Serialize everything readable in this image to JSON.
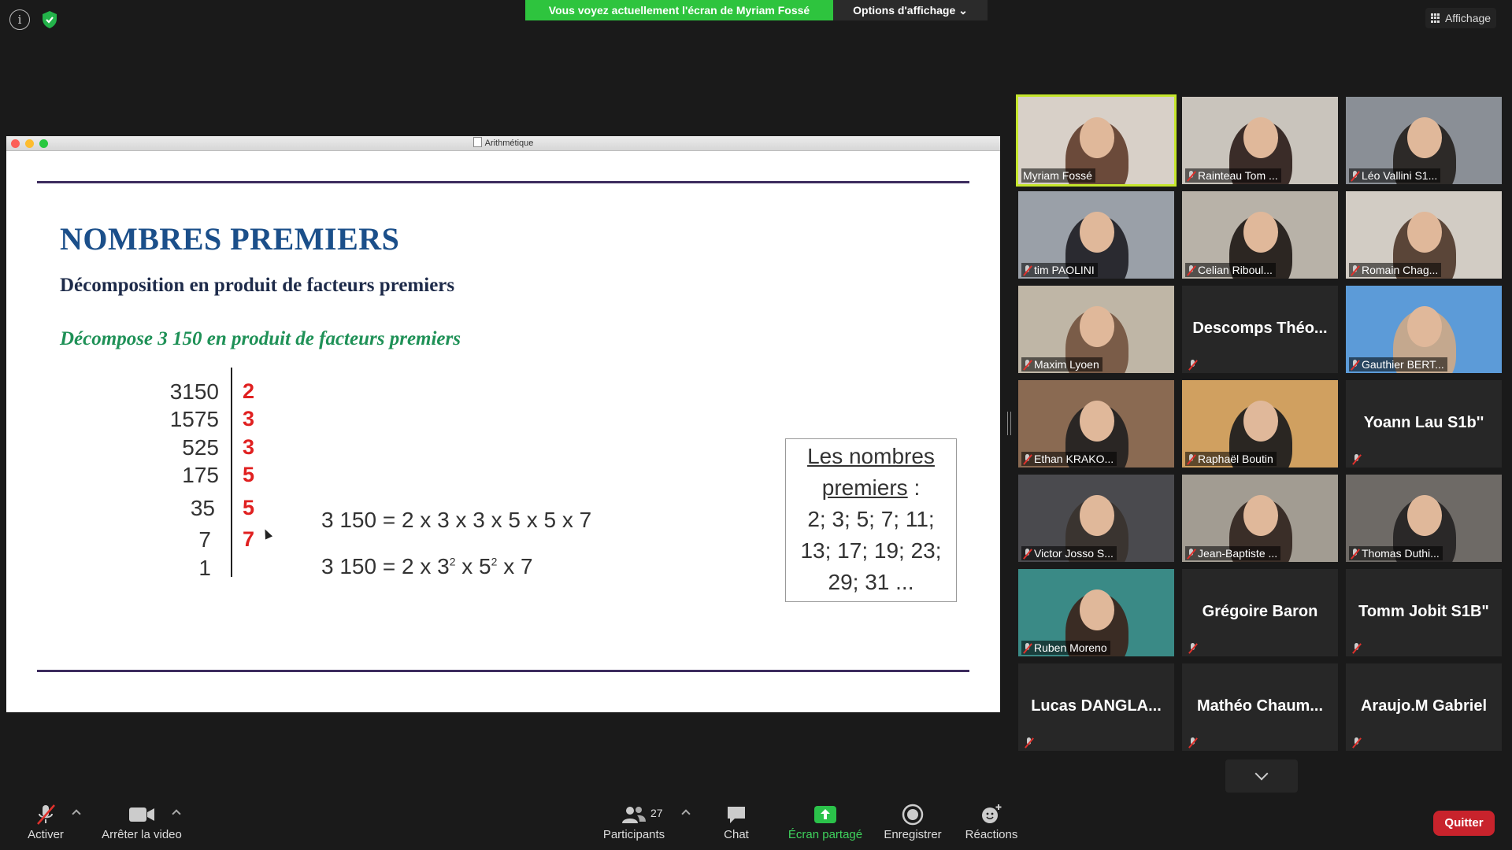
{
  "top": {
    "banner": "Vous voyez actuellement l'écran de Myriam Fossé",
    "view_options": "Options d'affichage ⌄",
    "layout": "Affichage"
  },
  "window": {
    "title": "Arithmétique"
  },
  "slide": {
    "title": "NOMBRES PREMIERS",
    "subtitle": "Décomposition en produit de facteurs premiers",
    "task": "Décompose 3 150 en produit de facteurs premiers",
    "dividends": [
      "3150",
      "1575",
      "525",
      "175",
      "35",
      "7",
      "1"
    ],
    "factors": [
      "2",
      "3",
      "3",
      "5",
      "5",
      "7"
    ],
    "eq1": "3 150 = 2 x 3 x 3 x 5 x 5 x 7",
    "eq2_a": "3 150 = 2 x 3",
    "eq2_exp1": "2",
    "eq2_b": " x 5",
    "eq2_exp2": "2",
    "eq2_c": " x 7",
    "box_line1": "Les nombres",
    "box_line2": "premiers",
    "box_line2_colon": " :",
    "box_line3": "2; 3; 5; 7; 11;",
    "box_line4": "13; 17; 19; 23;",
    "box_line5": "29; 31 ..."
  },
  "participants": [
    {
      "name": "Myriam Fossé",
      "video": true
    },
    {
      "name": "Rainteau Tom ...",
      "video": true
    },
    {
      "name": "Léo Vallini S1...",
      "video": true
    },
    {
      "name": "tim PAOLINI",
      "video": true
    },
    {
      "name": "Celian Riboul...",
      "video": true
    },
    {
      "name": "Romain Chag...",
      "video": true
    },
    {
      "name": "Maxim Lyoen",
      "video": true
    },
    {
      "name": "Descomps  Théo...",
      "video": false
    },
    {
      "name": "Gauthier BERT...",
      "video": true
    },
    {
      "name": "Ethan KRAKO...",
      "video": true
    },
    {
      "name": "Raphaël Boutin",
      "video": true
    },
    {
      "name": "Yoann Lau S1b''",
      "video": false
    },
    {
      "name": "Victor Josso S...",
      "video": true
    },
    {
      "name": "Jean-Baptiste ...",
      "video": true
    },
    {
      "name": "Thomas Duthi...",
      "video": true
    },
    {
      "name": "Ruben Moreno",
      "video": true
    },
    {
      "name": "Grégoire Baron",
      "video": false
    },
    {
      "name": "Tomm Jobit S1B\"",
      "video": false
    },
    {
      "name": "Lucas  DANGLA...",
      "video": false
    },
    {
      "name": "Mathéo  Chaum...",
      "video": false
    },
    {
      "name": "Araujo.M Gabriel",
      "video": false
    }
  ],
  "toolbar": {
    "unmute": "Activer",
    "stop_video": "Arrêter la video",
    "participants": "Participants",
    "participants_count": "27",
    "chat": "Chat",
    "share": "Écran partagé",
    "record": "Enregistrer",
    "reactions": "Réactions",
    "quit": "Quitter"
  },
  "colors": {
    "banner": "#2ec43e",
    "active_speaker": "#c5e62c",
    "slide_title": "#1b4f8a",
    "slide_task": "#1f9157",
    "factor": "#e02020",
    "quit": "#c8232c"
  }
}
